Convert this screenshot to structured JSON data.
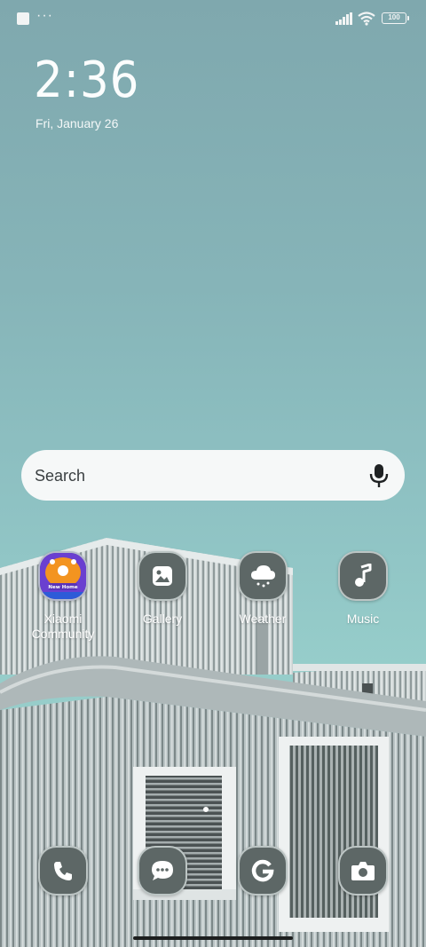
{
  "status_bar": {
    "notification_icon": "square-notification-icon",
    "overflow": "···",
    "signal_icon": "signal-icon",
    "wifi_icon": "wifi-icon",
    "battery": "100"
  },
  "lockscreen": {
    "time": "2:36",
    "date": "Fri, January 26"
  },
  "search": {
    "label": "Search",
    "mic_icon": "mic-icon"
  },
  "apps": [
    {
      "label": "Xiaomi Community",
      "icon": "xiaomi-community-icon",
      "badge_text": "New Home"
    },
    {
      "label": "Gallery",
      "icon": "gallery-icon"
    },
    {
      "label": "Weather",
      "icon": "weather-icon"
    },
    {
      "label": "Music",
      "icon": "music-icon"
    }
  ],
  "dock": [
    {
      "icon": "phone-icon"
    },
    {
      "icon": "messages-icon"
    },
    {
      "icon": "google-icon"
    },
    {
      "icon": "camera-icon"
    }
  ],
  "colors": {
    "sky_top": "#7fa8ae",
    "sky_bottom": "#9dcfca",
    "icon_bg": "#5d6766",
    "xiaomi_orange": "#f39420",
    "xiaomi_purple": "#6a3fd0"
  }
}
